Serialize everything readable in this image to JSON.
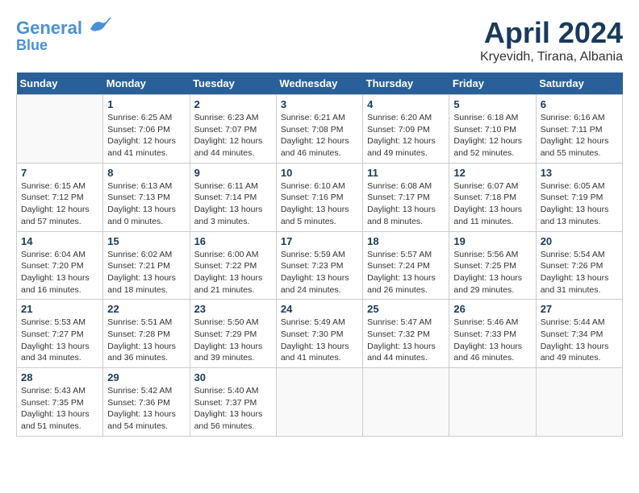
{
  "header": {
    "logo_line1": "General",
    "logo_line2": "Blue",
    "month": "April 2024",
    "location": "Kryevidh, Tirana, Albania"
  },
  "weekdays": [
    "Sunday",
    "Monday",
    "Tuesday",
    "Wednesday",
    "Thursday",
    "Friday",
    "Saturday"
  ],
  "weeks": [
    [
      {
        "day": "",
        "sunrise": "",
        "sunset": "",
        "daylight": ""
      },
      {
        "day": "1",
        "sunrise": "Sunrise: 6:25 AM",
        "sunset": "Sunset: 7:06 PM",
        "daylight": "Daylight: 12 hours and 41 minutes."
      },
      {
        "day": "2",
        "sunrise": "Sunrise: 6:23 AM",
        "sunset": "Sunset: 7:07 PM",
        "daylight": "Daylight: 12 hours and 44 minutes."
      },
      {
        "day": "3",
        "sunrise": "Sunrise: 6:21 AM",
        "sunset": "Sunset: 7:08 PM",
        "daylight": "Daylight: 12 hours and 46 minutes."
      },
      {
        "day": "4",
        "sunrise": "Sunrise: 6:20 AM",
        "sunset": "Sunset: 7:09 PM",
        "daylight": "Daylight: 12 hours and 49 minutes."
      },
      {
        "day": "5",
        "sunrise": "Sunrise: 6:18 AM",
        "sunset": "Sunset: 7:10 PM",
        "daylight": "Daylight: 12 hours and 52 minutes."
      },
      {
        "day": "6",
        "sunrise": "Sunrise: 6:16 AM",
        "sunset": "Sunset: 7:11 PM",
        "daylight": "Daylight: 12 hours and 55 minutes."
      }
    ],
    [
      {
        "day": "7",
        "sunrise": "Sunrise: 6:15 AM",
        "sunset": "Sunset: 7:12 PM",
        "daylight": "Daylight: 12 hours and 57 minutes."
      },
      {
        "day": "8",
        "sunrise": "Sunrise: 6:13 AM",
        "sunset": "Sunset: 7:13 PM",
        "daylight": "Daylight: 13 hours and 0 minutes."
      },
      {
        "day": "9",
        "sunrise": "Sunrise: 6:11 AM",
        "sunset": "Sunset: 7:14 PM",
        "daylight": "Daylight: 13 hours and 3 minutes."
      },
      {
        "day": "10",
        "sunrise": "Sunrise: 6:10 AM",
        "sunset": "Sunset: 7:16 PM",
        "daylight": "Daylight: 13 hours and 5 minutes."
      },
      {
        "day": "11",
        "sunrise": "Sunrise: 6:08 AM",
        "sunset": "Sunset: 7:17 PM",
        "daylight": "Daylight: 13 hours and 8 minutes."
      },
      {
        "day": "12",
        "sunrise": "Sunrise: 6:07 AM",
        "sunset": "Sunset: 7:18 PM",
        "daylight": "Daylight: 13 hours and 11 minutes."
      },
      {
        "day": "13",
        "sunrise": "Sunrise: 6:05 AM",
        "sunset": "Sunset: 7:19 PM",
        "daylight": "Daylight: 13 hours and 13 minutes."
      }
    ],
    [
      {
        "day": "14",
        "sunrise": "Sunrise: 6:04 AM",
        "sunset": "Sunset: 7:20 PM",
        "daylight": "Daylight: 13 hours and 16 minutes."
      },
      {
        "day": "15",
        "sunrise": "Sunrise: 6:02 AM",
        "sunset": "Sunset: 7:21 PM",
        "daylight": "Daylight: 13 hours and 18 minutes."
      },
      {
        "day": "16",
        "sunrise": "Sunrise: 6:00 AM",
        "sunset": "Sunset: 7:22 PM",
        "daylight": "Daylight: 13 hours and 21 minutes."
      },
      {
        "day": "17",
        "sunrise": "Sunrise: 5:59 AM",
        "sunset": "Sunset: 7:23 PM",
        "daylight": "Daylight: 13 hours and 24 minutes."
      },
      {
        "day": "18",
        "sunrise": "Sunrise: 5:57 AM",
        "sunset": "Sunset: 7:24 PM",
        "daylight": "Daylight: 13 hours and 26 minutes."
      },
      {
        "day": "19",
        "sunrise": "Sunrise: 5:56 AM",
        "sunset": "Sunset: 7:25 PM",
        "daylight": "Daylight: 13 hours and 29 minutes."
      },
      {
        "day": "20",
        "sunrise": "Sunrise: 5:54 AM",
        "sunset": "Sunset: 7:26 PM",
        "daylight": "Daylight: 13 hours and 31 minutes."
      }
    ],
    [
      {
        "day": "21",
        "sunrise": "Sunrise: 5:53 AM",
        "sunset": "Sunset: 7:27 PM",
        "daylight": "Daylight: 13 hours and 34 minutes."
      },
      {
        "day": "22",
        "sunrise": "Sunrise: 5:51 AM",
        "sunset": "Sunset: 7:28 PM",
        "daylight": "Daylight: 13 hours and 36 minutes."
      },
      {
        "day": "23",
        "sunrise": "Sunrise: 5:50 AM",
        "sunset": "Sunset: 7:29 PM",
        "daylight": "Daylight: 13 hours and 39 minutes."
      },
      {
        "day": "24",
        "sunrise": "Sunrise: 5:49 AM",
        "sunset": "Sunset: 7:30 PM",
        "daylight": "Daylight: 13 hours and 41 minutes."
      },
      {
        "day": "25",
        "sunrise": "Sunrise: 5:47 AM",
        "sunset": "Sunset: 7:32 PM",
        "daylight": "Daylight: 13 hours and 44 minutes."
      },
      {
        "day": "26",
        "sunrise": "Sunrise: 5:46 AM",
        "sunset": "Sunset: 7:33 PM",
        "daylight": "Daylight: 13 hours and 46 minutes."
      },
      {
        "day": "27",
        "sunrise": "Sunrise: 5:44 AM",
        "sunset": "Sunset: 7:34 PM",
        "daylight": "Daylight: 13 hours and 49 minutes."
      }
    ],
    [
      {
        "day": "28",
        "sunrise": "Sunrise: 5:43 AM",
        "sunset": "Sunset: 7:35 PM",
        "daylight": "Daylight: 13 hours and 51 minutes."
      },
      {
        "day": "29",
        "sunrise": "Sunrise: 5:42 AM",
        "sunset": "Sunset: 7:36 PM",
        "daylight": "Daylight: 13 hours and 54 minutes."
      },
      {
        "day": "30",
        "sunrise": "Sunrise: 5:40 AM",
        "sunset": "Sunset: 7:37 PM",
        "daylight": "Daylight: 13 hours and 56 minutes."
      },
      {
        "day": "",
        "sunrise": "",
        "sunset": "",
        "daylight": ""
      },
      {
        "day": "",
        "sunrise": "",
        "sunset": "",
        "daylight": ""
      },
      {
        "day": "",
        "sunrise": "",
        "sunset": "",
        "daylight": ""
      },
      {
        "day": "",
        "sunrise": "",
        "sunset": "",
        "daylight": ""
      }
    ]
  ]
}
